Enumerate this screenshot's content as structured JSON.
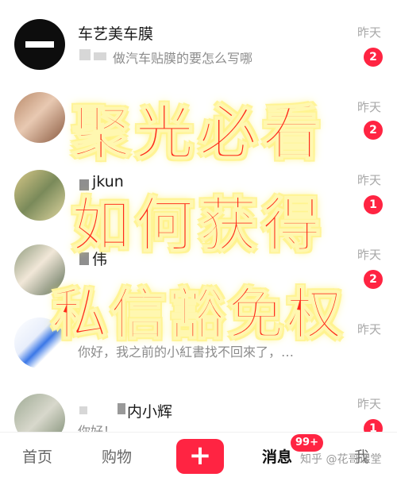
{
  "messages": [
    {
      "name": "车艺美车膜",
      "preview": "做汽车贴膜的要怎么写哪",
      "time": "昨天",
      "badge": "2"
    },
    {
      "name": "",
      "preview": "",
      "time": "昨天",
      "badge": "2"
    },
    {
      "name": "jkun",
      "preview": "",
      "time": "昨天",
      "badge": "1"
    },
    {
      "name": "伟",
      "preview": "",
      "time": "昨天",
      "badge": "2"
    },
    {
      "name": "",
      "preview": "你好，我之前的小紅書找不回來了，…",
      "time": "昨天",
      "badge": ""
    },
    {
      "name": "内小辉",
      "preview": "你好！",
      "time": "昨天",
      "badge": "1"
    }
  ],
  "headline": {
    "line1": "聚光必看",
    "line2": "如何获得",
    "line3": "私信豁免权"
  },
  "nav": {
    "home": "首页",
    "shop": "购物",
    "plus": "+",
    "messages": "消息",
    "messages_badge": "99+",
    "me": "我"
  },
  "watermark": "知乎 @花哥课堂",
  "colors": {
    "accent": "#ff2442",
    "headline": "#ff2a1a"
  }
}
